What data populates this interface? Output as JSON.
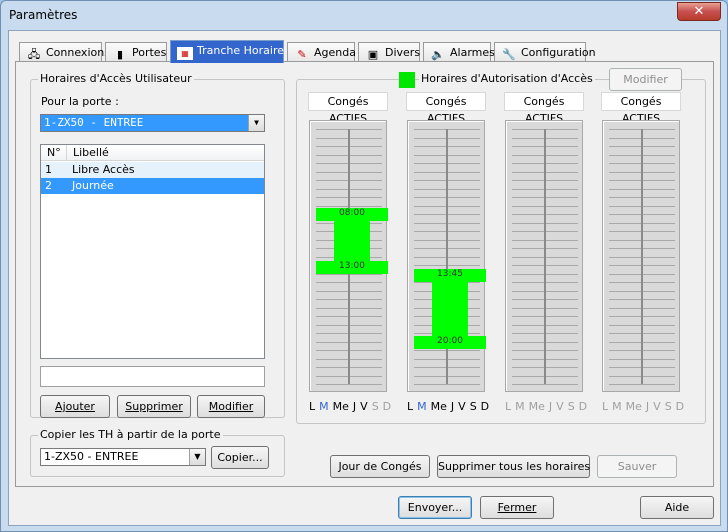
{
  "window": {
    "title": "Paramètres",
    "close_label": "✕"
  },
  "tabs": [
    {
      "label": "Connexions",
      "icon": "network-icon"
    },
    {
      "label": "Portes",
      "icon": "door-icon"
    },
    {
      "label": "Tranche Horaire",
      "icon": "clock-icon"
    },
    {
      "label": "Agenda",
      "icon": "agenda-icon"
    },
    {
      "label": "Divers",
      "icon": "gear-icon"
    },
    {
      "label": "Alarmes",
      "icon": "speaker-icon"
    },
    {
      "label": "Configuration",
      "icon": "wrench-icon"
    }
  ],
  "left_group": {
    "title": "Horaires d'Accès Utilisateur",
    "door_label": "Pour la porte :",
    "door_value": "1-ZX50 - ENTREE",
    "columns": [
      "N°",
      "Libellé"
    ],
    "rows": [
      {
        "num": "1",
        "label": "Libre Accès"
      },
      {
        "num": "2",
        "label": "Journée"
      }
    ],
    "edit_value": "",
    "buttons": {
      "add": "Ajouter",
      "delete": "Supprimer",
      "modify": "Modifier"
    }
  },
  "copy_group": {
    "title": "Copier les TH à partir de la porte",
    "door_value": "1-ZX50 - ENTREE",
    "copy_button": "Copier..."
  },
  "right_group": {
    "title": "Horaires d'Autorisation d'Accès",
    "modify_button": "Modifier",
    "legend_color": "#00e600",
    "columns": [
      {
        "header": "Congés ACTIFS",
        "start": "08:00",
        "end": "13:00",
        "days": [
          "L",
          "M",
          "Me",
          "J",
          "V",
          "S",
          "D"
        ],
        "active": [
          true,
          true,
          true,
          true,
          true,
          false,
          false
        ]
      },
      {
        "header": "Congés ACTIFS",
        "start": "13:45",
        "end": "20:00",
        "days": [
          "L",
          "M",
          "Me",
          "J",
          "V",
          "S",
          "D"
        ],
        "active": [
          true,
          true,
          true,
          true,
          true,
          true,
          true
        ]
      },
      {
        "header": "Congés ACTIFS",
        "days": [
          "L",
          "M",
          "Me",
          "J",
          "V",
          "S",
          "D"
        ],
        "active": [
          false,
          false,
          false,
          false,
          false,
          false,
          false
        ]
      },
      {
        "header": "Congés ACTIFS",
        "days": [
          "L",
          "M",
          "Me",
          "J",
          "V",
          "S",
          "D"
        ],
        "active": [
          false,
          false,
          false,
          false,
          false,
          false,
          false
        ]
      }
    ],
    "buttons": {
      "holiday": "Jour de Congés",
      "delete_all": "Supprimer tous les horaires",
      "save": "Sauver"
    }
  },
  "footer": {
    "send": "Envoyer...",
    "close": "Fermer",
    "help": "Aide"
  }
}
